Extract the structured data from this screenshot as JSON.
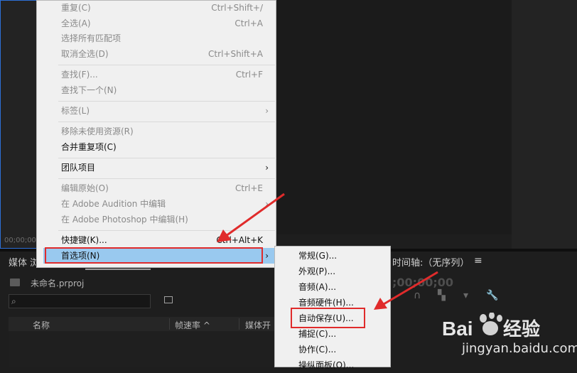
{
  "background": {
    "timecode_left": "00;00;00;",
    "media_browser_tab": "媒体 浏",
    "timeline_tab": "时间轴:（无序列）",
    "timeline_menu_icon": "menu-icon",
    "timeline_timecode": ";00;00;00",
    "project_name": "未命名.prproj",
    "columns": [
      "名称",
      "帧速率 ^",
      "媒体开"
    ]
  },
  "edit_menu": {
    "items": [
      {
        "label": "重复(C)",
        "shortcut": "Ctrl+Shift+/",
        "enabled": false
      },
      {
        "label": "全选(A)",
        "shortcut": "Ctrl+A",
        "enabled": false
      },
      {
        "label": "选择所有匹配项",
        "shortcut": "",
        "enabled": false
      },
      {
        "label": "取消全选(D)",
        "shortcut": "Ctrl+Shift+A",
        "enabled": false
      },
      {
        "label": "查找(F)...",
        "shortcut": "Ctrl+F",
        "enabled": false
      },
      {
        "label": "查找下一个(N)",
        "shortcut": "",
        "enabled": false
      },
      {
        "label": "标签(L)",
        "shortcut": "",
        "enabled": false,
        "submenu": true
      },
      {
        "label": "移除未使用资源(R)",
        "shortcut": "",
        "enabled": false
      },
      {
        "label": "合并重复项(C)",
        "shortcut": "",
        "enabled": true
      },
      {
        "label": "团队项目",
        "shortcut": "",
        "enabled": true,
        "submenu": true
      },
      {
        "label": "编辑原始(O)",
        "shortcut": "Ctrl+E",
        "enabled": false
      },
      {
        "label": "在 Adobe Audition 中编辑",
        "shortcut": "",
        "enabled": false,
        "submenu": true
      },
      {
        "label": "在 Adobe Photoshop 中编辑(H)",
        "shortcut": "",
        "enabled": false
      },
      {
        "label": "快捷键(K)...",
        "shortcut": "Ctrl+Alt+K",
        "enabled": true
      },
      {
        "label": "首选项(N)",
        "shortcut": "",
        "enabled": true,
        "submenu": true,
        "highlighted": true
      }
    ],
    "submenu_arrow": "›"
  },
  "preferences_submenu": {
    "items": [
      {
        "label": "常规(G)..."
      },
      {
        "label": "外观(P)..."
      },
      {
        "label": "音频(A)..."
      },
      {
        "label": "音频硬件(H)..."
      },
      {
        "label": "自动保存(U)...",
        "annotated": true
      },
      {
        "label": "捕捉(C)..."
      },
      {
        "label": "协作(C)..."
      },
      {
        "label": "操纵面板(O)..."
      }
    ]
  },
  "colors": {
    "highlight": "#99c9ef",
    "annotation_red": "#e02b2b"
  },
  "watermark": {
    "logo_text": "Bai经验",
    "url": "jingyan.baidu.com"
  }
}
